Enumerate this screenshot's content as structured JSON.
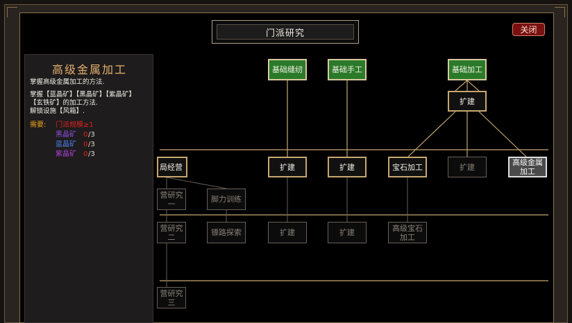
{
  "window": {
    "title": "门派研究",
    "close_label": "关闭"
  },
  "info_panel": {
    "title": "高级金属加工",
    "summary": "掌握高级金属加工的方法.",
    "desc_lines": [
      "掌握【蓝晶矿】【黑晶矿】【紫晶矿】",
      "【玄铁矿】的加工方法.",
      "解锁设施【风箱】."
    ],
    "requirements_label": "需要:",
    "requirements": [
      {
        "name": "门派规模≥1",
        "have": "",
        "need": "",
        "name_color": "#e02020"
      },
      {
        "name": "黑晶矿",
        "have": "0",
        "need": "/3",
        "name_color": "#9050e0"
      },
      {
        "name": "蓝晶矿",
        "have": "0",
        "need": "/3",
        "name_color": "#5080f0"
      },
      {
        "name": "紫晶矿",
        "have": "0",
        "need": "/3",
        "name_color": "#b040e0"
      }
    ]
  },
  "colors": {
    "requirement_count": "#e02020",
    "line": "#c8a870",
    "accent": "#e6b070"
  },
  "nodes": {
    "jichu_fengren": "基础缝纫",
    "jichu_shougong": "基础手工",
    "jichu_jiagong": "基础加工",
    "kuojian_top": "扩建",
    "ju_jingying": "局经营",
    "kuojian_r1_a": "扩建",
    "kuojian_r1_b": "扩建",
    "baoshi_jiagong": "宝石加工",
    "kuojian_r1_c": "扩建",
    "gaoji_jinshu_1": "高级金属",
    "gaoji_jinshu_2": "加工",
    "ying_yanjiu_1a": "营研究",
    "ying_yanjiu_1b": "一",
    "jiaoli_xunlian": "脚力训练",
    "ying_yanjiu_2a": "营研究",
    "ying_yanjiu_2b": "二",
    "biaolu_tansuo": "镖路探索",
    "kuojian_r2_a": "扩建",
    "kuojian_r2_b": "扩建",
    "gaoji_baoshi_1": "高级宝石",
    "gaoji_baoshi_2": "加工",
    "ying_yanjiu_3a": "营研究",
    "ying_yanjiu_3b": "三"
  }
}
